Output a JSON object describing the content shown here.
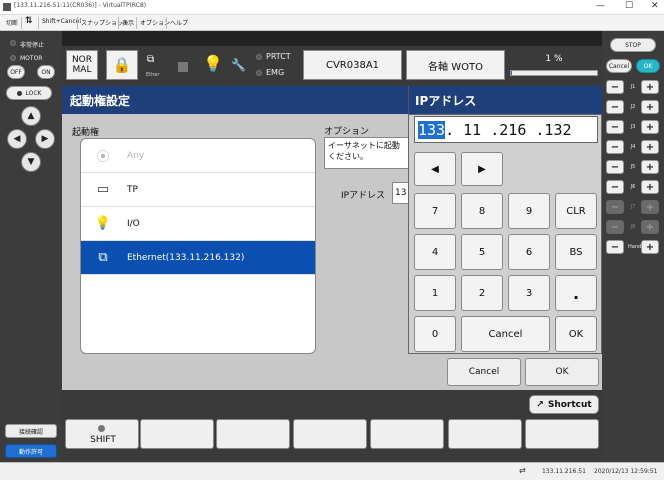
{
  "window": {
    "title": "[133.11.216.51:11(CR036)] - VirtualTP(RC8)",
    "minimize": "—",
    "maximize": "☐",
    "close": "✕"
  },
  "menu": {
    "cut": "切断",
    "shift_cancel": "Shift+Cancel",
    "snapshot": "スナップショット",
    "view": "表示",
    "option": "オプション",
    "help": "ヘルプ"
  },
  "left_panel": {
    "emergency_label": "非常停止",
    "motor_label": "MOTOR",
    "motor_off": "OFF",
    "motor_on": "ON",
    "lock_label": "LOCK",
    "btn_confirm": "接続確認",
    "btn_permit": "動作許可"
  },
  "right_panel": {
    "stop": "STOP",
    "cancel": "Cancel",
    "ok": "OK",
    "joints": [
      {
        "label": "J1",
        "enabled": true
      },
      {
        "label": "J2",
        "enabled": true
      },
      {
        "label": "J3",
        "enabled": true
      },
      {
        "label": "J4",
        "enabled": true
      },
      {
        "label": "J5",
        "enabled": true
      },
      {
        "label": "J6",
        "enabled": true
      },
      {
        "label": "J7",
        "enabled": false
      },
      {
        "label": "J8",
        "enabled": false
      },
      {
        "label": "Hand",
        "enabled": true
      }
    ],
    "minus": "−",
    "plus": "+"
  },
  "toolbar": {
    "mode": "NOR\nMAL",
    "ether": "Ether",
    "prtct": "PRTCT",
    "emg": "EMG",
    "robot": "CVR038A1",
    "axis": "各軸 WOTO",
    "speed": "1 %",
    "speed_fraction": 0.01
  },
  "dialog": {
    "title": "起動権設定",
    "section_owner": "起動権",
    "section_option": "オプション",
    "option_text_1": "イーサネットに起動",
    "option_text_2": "ください。",
    "ip_label": "IPアドレス",
    "ip_value_hint": "13",
    "items": [
      {
        "icon": "⦿",
        "label": "Any",
        "state": "disabled"
      },
      {
        "icon": "▭",
        "label": "TP",
        "state": "normal"
      },
      {
        "icon": "💡",
        "label": "I/O",
        "state": "normal"
      },
      {
        "icon": "⧉",
        "label": "Ethernet(133.11.216.132)",
        "state": "selected"
      }
    ],
    "cancel": "Cancel",
    "ok": "OK"
  },
  "keypad": {
    "title": "IPアドレス",
    "ip_highlight": "133",
    "ip_rest": ". 11 .216 .132",
    "left_arrow": "◀",
    "right_arrow": "▶",
    "keys": [
      "7",
      "8",
      "9",
      "CLR",
      "4",
      "5",
      "6",
      "BS",
      "1",
      "2",
      "3",
      ".",
      "0",
      "Cancel",
      "OK"
    ]
  },
  "fnbar": {
    "shortcut": "Shortcut",
    "shift": "SHIFT"
  },
  "status": {
    "ip": "133.11.216.51",
    "datetime": "2020/12/13 12:59:51"
  }
}
